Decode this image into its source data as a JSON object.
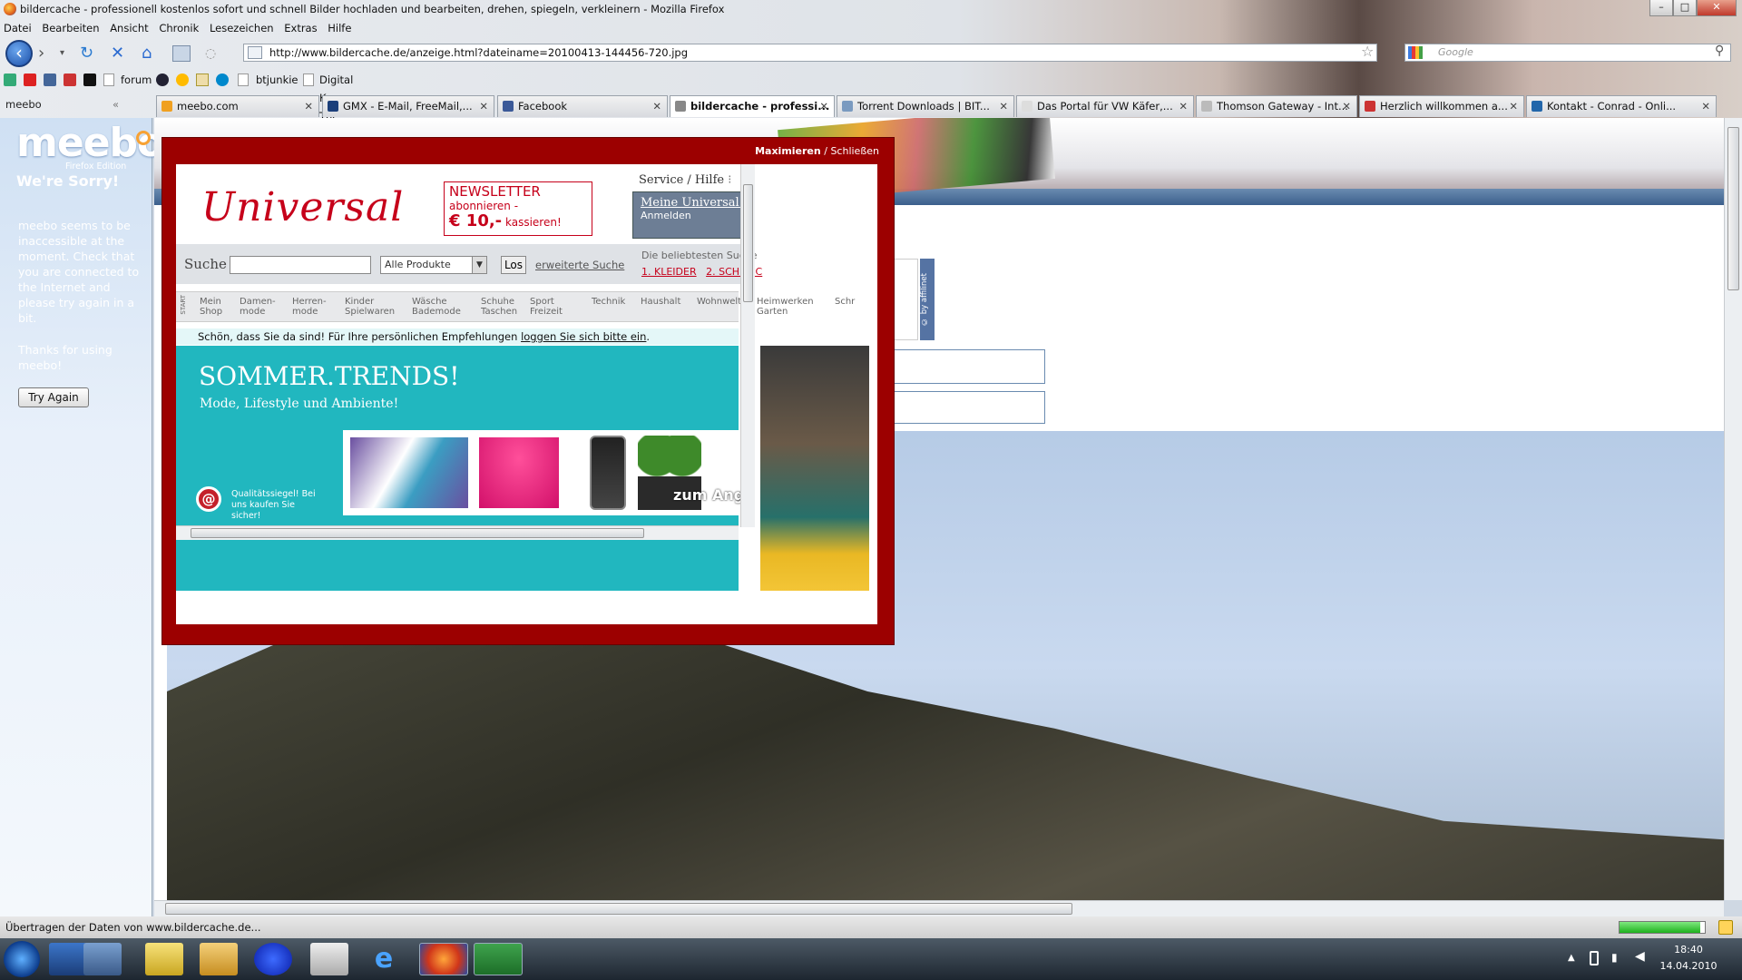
{
  "window": {
    "title": "bildercache - professionell kostenlos sofort und schnell Bilder hochladen und bearbeiten, drehen, spiegeln, verkleinern - Mozilla Firefox",
    "controls": [
      "–",
      "□",
      "✕"
    ]
  },
  "menubar": [
    "Datei",
    "Bearbeiten",
    "Ansicht",
    "Chronik",
    "Lesezeichen",
    "Extras",
    "Hilfe"
  ],
  "navbar": {
    "url": "http://www.bildercache.de/anzeige.html?dateiname=20100413-144456-720.jpg",
    "search_placeholder": "Google"
  },
  "bookmarks": [
    "forum",
    "btjunkie",
    "Digital Kaos - The Cabl..."
  ],
  "sidebar_header": "meebo",
  "tabs": [
    {
      "label": "meebo.com",
      "active": false,
      "icon_color": "#f0a020"
    },
    {
      "label": "GMX - E-Mail, FreeMail,...",
      "active": false,
      "icon_color": "#1b3f7a"
    },
    {
      "label": "Facebook",
      "active": false,
      "icon_color": "#3b5998"
    },
    {
      "label": "bildercache - professi...",
      "active": true,
      "icon_color": "#888888"
    },
    {
      "label": "Torrent Downloads | BIT...",
      "active": false,
      "icon_color": "#7a9ac0"
    },
    {
      "label": "Das Portal für VW Käfer,...",
      "active": false,
      "icon_color": "#dddddd"
    },
    {
      "label": "Thomson Gateway - Int...",
      "active": false,
      "icon_color": "#bbbbbb"
    },
    {
      "label": "Herzlich willkommen a...",
      "active": false,
      "icon_color": "#cc3333"
    },
    {
      "label": "Kontakt - Conrad - Onli...",
      "active": false,
      "icon_color": "#2266aa"
    }
  ],
  "meebo": {
    "logo": "meebo",
    "edition": "Firefox Edition",
    "sorry": "We're Sorry!",
    "message": "meebo seems to be inaccessible at the moment. Check that you are connected to the Internet and please try again in a bit.",
    "thanks": "Thanks for using meebo!",
    "retry": "Try Again"
  },
  "popup": {
    "maximize": "Maximieren",
    "separator": " / ",
    "close": "Schließen",
    "ad": {
      "logo": "Universal",
      "newsletter_title": "NEWSLETTER",
      "newsletter_sub": "abonnieren -",
      "newsletter_amount": "€ 10,-",
      "newsletter_cta": "kassieren!",
      "service": "Service / Hilfe",
      "meine_title": "Meine Universal We",
      "meine_login": "Anmelden",
      "search_label": "Suche",
      "category_select": "Alle Produkte",
      "go_button": "Los",
      "advanced_search": "erweiterte Suche",
      "popular_title": "Die beliebtesten Suche",
      "popular_items": [
        "1. KLEIDER",
        "2. SCHMUC"
      ],
      "start_label": "START",
      "categories": [
        [
          "Mein",
          "Shop"
        ],
        [
          "Damen-",
          "mode"
        ],
        [
          "Herren-",
          "mode"
        ],
        [
          "Kinder",
          "Spielwaren"
        ],
        [
          "Wäsche",
          "Bademode"
        ],
        [
          "Schuhe",
          "Taschen"
        ],
        [
          "Sport",
          "Freizeit"
        ],
        [
          "Technik",
          ""
        ],
        [
          "Haushalt",
          ""
        ],
        [
          "Wohnwelt",
          ""
        ],
        [
          "Heimwerken",
          "Garten"
        ],
        [
          "Schr",
          ""
        ]
      ],
      "welcome_text": "Schön, dass Sie da sind! Für Ihre persönlichen Empfehlungen",
      "welcome_link": "loggen Sie sich bitte ein",
      "welcome_end": ".",
      "teaser_title": "SOMMER.TRENDS!",
      "teaser_sub": "Mode, Lifestyle und Ambiente!",
      "seal_text": "Qualitätssiegel! Bei uns kaufen Sie sicher!",
      "zum_angebot": "zum Ang"
    }
  },
  "page_widget": {
    "lines": [
      "t",
      "oo",
      "??"
    ],
    "affilinet": "© by affilinet"
  },
  "statusbar": {
    "text": "Übertragen der Daten von www.bildercache.de..."
  },
  "taskbar": {
    "time": "18:40",
    "date": "14.04.2010"
  }
}
